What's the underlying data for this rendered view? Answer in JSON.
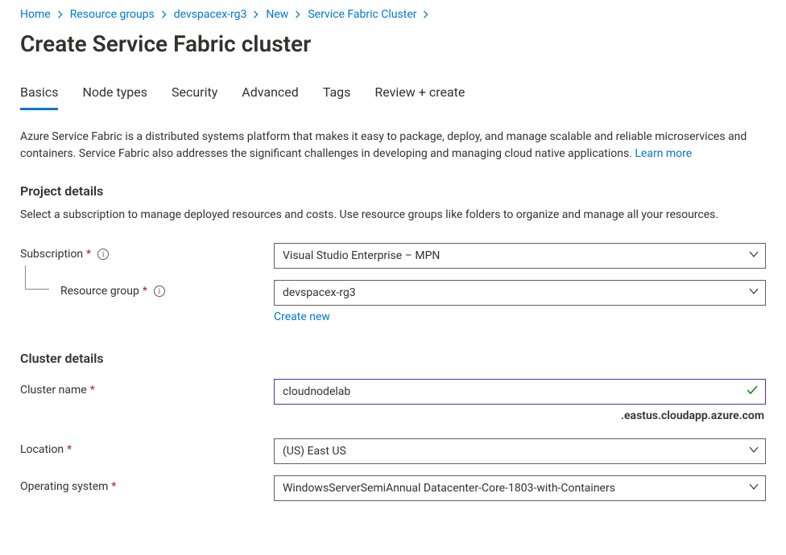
{
  "breadcrumb": [
    {
      "label": "Home"
    },
    {
      "label": "Resource groups"
    },
    {
      "label": "devspacex-rg3"
    },
    {
      "label": "New"
    },
    {
      "label": "Service Fabric Cluster"
    }
  ],
  "page_title": "Create Service Fabric cluster",
  "tabs": [
    {
      "label": "Basics",
      "active": true
    },
    {
      "label": "Node types"
    },
    {
      "label": "Security"
    },
    {
      "label": "Advanced"
    },
    {
      "label": "Tags"
    },
    {
      "label": "Review + create"
    }
  ],
  "intro_text": "Azure Service Fabric is a distributed systems platform that makes it easy to package, deploy, and manage scalable and reliable microservices and containers. Service Fabric also addresses the significant challenges in developing and managing cloud native applications.  ",
  "learn_more": "Learn more",
  "project_details": {
    "heading": "Project details",
    "desc": "Select a subscription to manage deployed resources and costs. Use resource groups like folders to organize and manage all your resources.",
    "subscription_label": "Subscription",
    "subscription_value": "Visual Studio Enterprise – MPN",
    "resource_group_label": "Resource group",
    "resource_group_value": "devspacex-rg3",
    "create_new": "Create new"
  },
  "cluster_details": {
    "heading": "Cluster details",
    "cluster_name_label": "Cluster name",
    "cluster_name_value": "cloudnodelab",
    "dns_suffix": ".eastus.cloudapp.azure.com",
    "location_label": "Location",
    "location_value": "(US) East US",
    "os_label": "Operating system",
    "os_value": "WindowsServerSemiAnnual Datacenter-Core-1803-with-Containers"
  }
}
